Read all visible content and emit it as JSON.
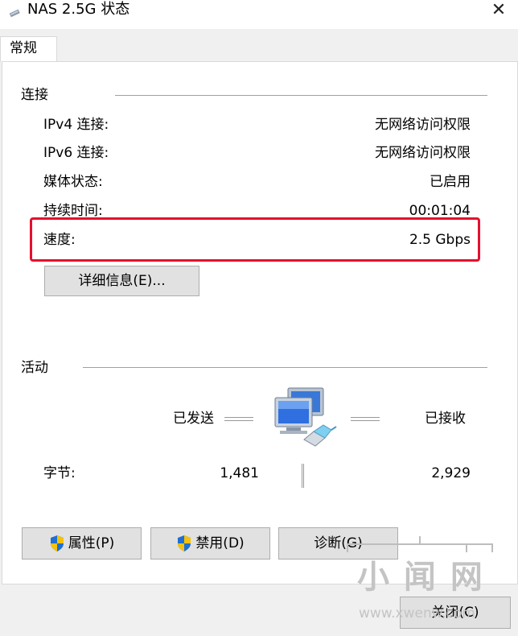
{
  "window": {
    "title": "NAS 2.5G 状态"
  },
  "tabs": [
    {
      "label": "常规"
    }
  ],
  "connection": {
    "section_title": "连接",
    "rows": [
      {
        "label": "IPv4 连接:",
        "value": "无网络访问权限"
      },
      {
        "label": "IPv6 连接:",
        "value": "无网络访问权限"
      },
      {
        "label": "媒体状态:",
        "value": "已启用"
      },
      {
        "label": "持续时间:",
        "value": "00:01:04"
      },
      {
        "label": "速度:",
        "value": "2.5 Gbps"
      }
    ],
    "details_button": "详细信息(E)..."
  },
  "activity": {
    "section_title": "活动",
    "sent_label": "已发送",
    "received_label": "已接收",
    "bytes_label": "字节:",
    "bytes_sent": "1,481",
    "bytes_received": "2,929"
  },
  "buttons": {
    "properties": "属性(P)",
    "disable": "禁用(D)",
    "diagnose": "诊断(G)",
    "close": "关闭(C)"
  },
  "watermark": {
    "text": "小 闻 网",
    "url": "www.xwenw.com"
  },
  "colors": {
    "highlight": "#e3102d",
    "shield_blue": "#1f6fd1",
    "shield_yellow": "#f4c20d"
  }
}
